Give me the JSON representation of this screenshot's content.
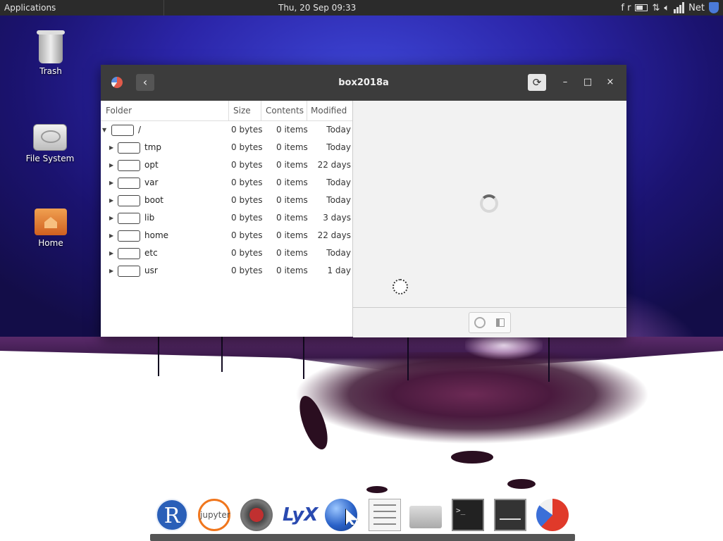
{
  "top_panel": {
    "applications_label": "Applications",
    "clock": "Thu, 20 Sep  09:33",
    "tray_keyboard": "f r",
    "tray_net": "Net"
  },
  "desktop_icons": [
    {
      "label": "Trash",
      "icon": "trash-icon"
    },
    {
      "label": "File System",
      "icon": "drive-icon"
    },
    {
      "label": "Home",
      "icon": "home-folder-icon"
    }
  ],
  "window": {
    "title": "box2018a",
    "back_glyph": "‹",
    "reload_glyph": "⟳",
    "minimize_glyph": "–",
    "maximize_glyph": "□",
    "close_glyph": "×",
    "columns": [
      "Folder",
      "Size",
      "Contents",
      "Modified"
    ],
    "rows": [
      {
        "name": "/",
        "size": "0 bytes",
        "contents": "0 items",
        "modified": "Today",
        "expanded": true
      },
      {
        "name": "tmp",
        "size": "0 bytes",
        "contents": "0 items",
        "modified": "Today",
        "expanded": false
      },
      {
        "name": "opt",
        "size": "0 bytes",
        "contents": "0 items",
        "modified": "22 days",
        "expanded": false
      },
      {
        "name": "var",
        "size": "0 bytes",
        "contents": "0 items",
        "modified": "Today",
        "expanded": false
      },
      {
        "name": "boot",
        "size": "0 bytes",
        "contents": "0 items",
        "modified": "Today",
        "expanded": false
      },
      {
        "name": "lib",
        "size": "0 bytes",
        "contents": "0 items",
        "modified": "3 days",
        "expanded": false
      },
      {
        "name": "home",
        "size": "0 bytes",
        "contents": "0 items",
        "modified": "22 days",
        "expanded": false
      },
      {
        "name": "etc",
        "size": "0 bytes",
        "contents": "0 items",
        "modified": "Today",
        "expanded": false
      },
      {
        "name": "usr",
        "size": "0 bytes",
        "contents": "0 items",
        "modified": "1 day",
        "expanded": false
      }
    ]
  },
  "dock": {
    "items": [
      {
        "icon": "r-icon",
        "text": "R"
      },
      {
        "icon": "jupyter-icon",
        "text": "jupyter"
      },
      {
        "icon": "spyder-icon"
      },
      {
        "icon": "lyx-icon",
        "text": "LyX"
      },
      {
        "icon": "web-browser-icon"
      },
      {
        "icon": "text-editor-icon"
      },
      {
        "icon": "file-manager-icon"
      },
      {
        "icon": "terminal-icon",
        "text": ">_"
      },
      {
        "icon": "system-monitor-icon"
      },
      {
        "icon": "disk-usage-icon"
      }
    ]
  }
}
